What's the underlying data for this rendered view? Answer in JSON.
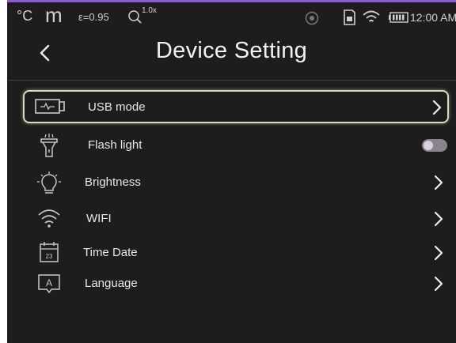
{
  "status_bar": {
    "unit": "°C",
    "mode": "m",
    "emissivity": "ε=0.95",
    "zoom": "1.0x",
    "time": "12:00 AM"
  },
  "header": {
    "title": "Device Setting",
    "back_icon": "chevron-left-icon"
  },
  "settings": [
    {
      "label": "USB mode",
      "icon": "usb-icon",
      "control": "chevron",
      "selected": true
    },
    {
      "label": "Flash light",
      "icon": "flashlight-icon",
      "control": "toggle",
      "on": false
    },
    {
      "label": "Brightness",
      "icon": "lightbulb-icon",
      "control": "chevron"
    },
    {
      "label": "WIFI",
      "icon": "wifi-icon",
      "control": "chevron"
    },
    {
      "label": "Time Date",
      "icon": "calendar-icon",
      "control": "chevron",
      "icon_text": "23"
    },
    {
      "label": "Language",
      "icon": "language-icon",
      "control": "chevron",
      "icon_text": "A"
    }
  ],
  "colors": {
    "background": "#1d1d1d",
    "accent_bar": "#8c5bd6",
    "selection_border": "#d7dcc0",
    "toggle_off": "#8a828f"
  }
}
